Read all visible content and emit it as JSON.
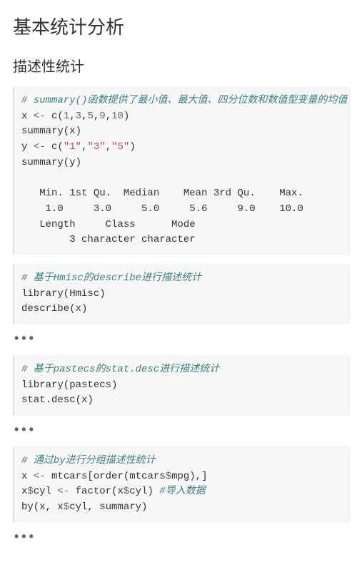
{
  "heading": "基本统计分析",
  "subheading": "描述性统计",
  "blocks": [
    {
      "id": "block1",
      "comment": "# summary()函数提供了最小值、最大值、四分位数和数值型变量的均值",
      "code_lines": [
        "x <- c(1,3,5,9,10)",
        "summary(x)",
        "y <- c(\"1\",\"3\",\"5\")",
        "summary(y)"
      ],
      "output_lines": [
        "   Min. 1st Qu.  Median    Mean 3rd Qu.    Max. ",
        "    1.0     3.0     5.0     5.6     9.0    10.0 ",
        "   Length     Class      Mode ",
        "        3 character character "
      ]
    },
    {
      "id": "block2",
      "comment": "# 基于Hmisc的describe进行描述统计",
      "code_lines": [
        "library(Hmisc)",
        "describe(x)"
      ]
    },
    {
      "id": "block3",
      "comment": "# 基于pastecs的stat.desc进行描述统计",
      "code_lines": [
        "library(pastecs)",
        "stat.desc(x)"
      ]
    },
    {
      "id": "block4",
      "comment": "# 通过by进行分组描述性统计",
      "comment2": "#导入数据",
      "code_lines": [
        "x <- mtcars[order(mtcars$mpg),]",
        "x$cyl <- factor(x$cyl)",
        "by(x, x$cyl, summary)"
      ]
    }
  ],
  "ellipsis": "•••"
}
